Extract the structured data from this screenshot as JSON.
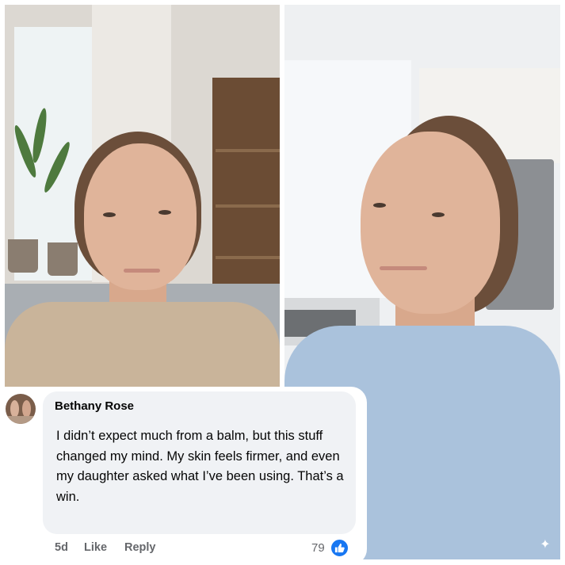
{
  "comment": {
    "author": "Bethany Rose",
    "text": "I didn’t expect much from a balm, but this stuff changed my mind. My skin feels firmer, and even my daughter asked what I’ve been using. That’s a win.",
    "time": "5d",
    "like_label": "Like",
    "reply_label": "Reply",
    "reaction_count": "79",
    "reaction_icon": "thumbs-up-icon",
    "reaction_color": "#1877f2"
  },
  "photos": {
    "left": "before-photo",
    "right": "after-photo"
  },
  "watermark_icon": "sparkle-icon"
}
